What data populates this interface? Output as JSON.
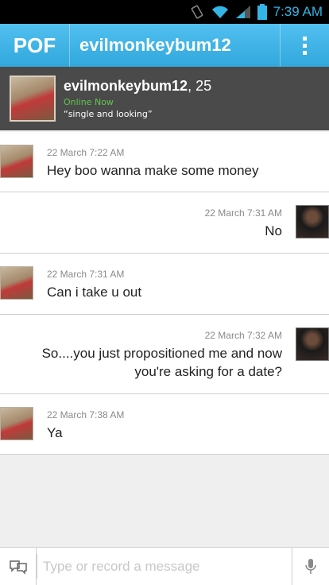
{
  "status_bar": {
    "time": "7:39 AM"
  },
  "action_bar": {
    "logo": "POF",
    "title": "evilmonkeybum12"
  },
  "profile": {
    "name": "evilmonkeybum12",
    "age_suffix": ", 25",
    "status": "Online Now",
    "tagline": "“single and looking”"
  },
  "messages": [
    {
      "direction": "in",
      "time": "22 March 7:22 AM",
      "lines": [
        "Hey boo wanna make some money"
      ]
    },
    {
      "direction": "out",
      "time": "22 March 7:31 AM",
      "lines": [
        "No"
      ]
    },
    {
      "direction": "in",
      "time": "22 March 7:31 AM",
      "lines": [
        "Can i take u out"
      ]
    },
    {
      "direction": "out",
      "time": "22 March 7:32 AM",
      "lines": [
        "So....you just propositioned me and now",
        "you're asking for a date?"
      ]
    },
    {
      "direction": "in",
      "time": "22 March 7:38 AM",
      "lines": [
        "Ya"
      ]
    }
  ],
  "composer": {
    "placeholder": "Type or record a message"
  },
  "colors": {
    "accent": "#33b5e5",
    "online": "#5fc64b"
  }
}
